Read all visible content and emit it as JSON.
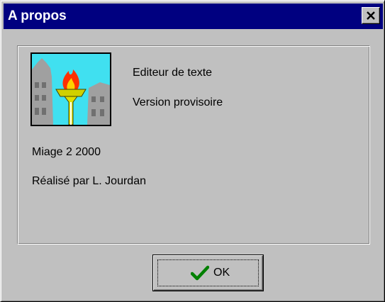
{
  "window": {
    "title": "A propos",
    "close_icon": "close-icon"
  },
  "about": {
    "app_name": "Editeur de texte",
    "version": "Version provisoire",
    "course": "Miage 2 2000",
    "author": "Réalisé par L. Jourdan",
    "logo": "torch-logo-icon"
  },
  "buttons": {
    "ok_label": "OK",
    "ok_icon": "checkmark-icon"
  },
  "colors": {
    "titlebar": "#000080",
    "face": "#c0c0c0",
    "logo_bg": "#40e0f0",
    "check": "#008000"
  }
}
